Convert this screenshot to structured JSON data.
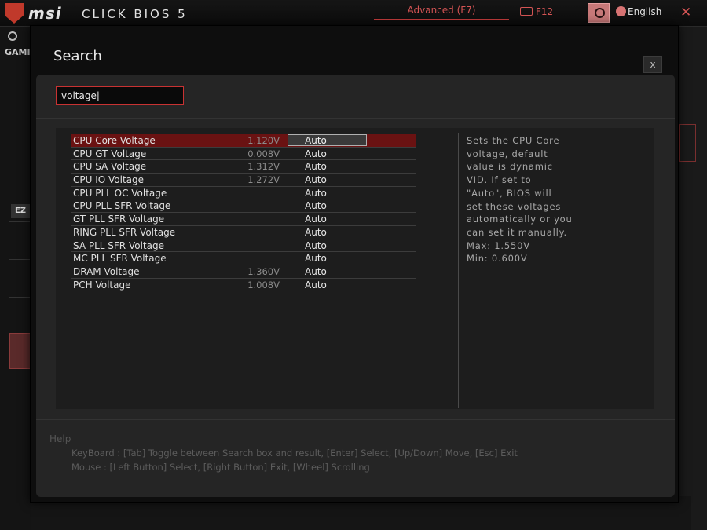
{
  "app": {
    "logo": "msi",
    "title": "CLICK BIOS 5",
    "mode_label": "Advanced (F7)",
    "screenshot_label": "F12",
    "language": "English"
  },
  "background": {
    "game_label": "GAMI",
    "ez_label": "EZ"
  },
  "modal": {
    "title": "Search",
    "close_label": "x",
    "search_value": "voltage|",
    "results": [
      {
        "name": "CPU Core Voltage",
        "current": "1.120V",
        "value": "Auto",
        "selected": true
      },
      {
        "name": "CPU GT Voltage",
        "current": "0.008V",
        "value": "Auto",
        "selected": false
      },
      {
        "name": "CPU SA Voltage",
        "current": "1.312V",
        "value": "Auto",
        "selected": false
      },
      {
        "name": "CPU IO Voltage",
        "current": "1.272V",
        "value": "Auto",
        "selected": false
      },
      {
        "name": "CPU PLL OC Voltage",
        "current": "",
        "value": "Auto",
        "selected": false
      },
      {
        "name": "CPU PLL SFR Voltage",
        "current": "",
        "value": "Auto",
        "selected": false
      },
      {
        "name": "GT PLL SFR Voltage",
        "current": "",
        "value": "Auto",
        "selected": false
      },
      {
        "name": "RING PLL SFR Voltage",
        "current": "",
        "value": "Auto",
        "selected": false
      },
      {
        "name": "SA PLL SFR Voltage",
        "current": "",
        "value": "Auto",
        "selected": false
      },
      {
        "name": "MC PLL SFR Voltage",
        "current": "",
        "value": "Auto",
        "selected": false
      },
      {
        "name": "DRAM Voltage",
        "current": "1.360V",
        "value": "Auto",
        "selected": false
      },
      {
        "name": "PCH Voltage",
        "current": "1.008V",
        "value": "Auto",
        "selected": false
      }
    ],
    "description": [
      "Sets the CPU Core",
      "voltage, default",
      "value is dynamic",
      "VID. If set to",
      "\"Auto\", BIOS will",
      "set these voltages",
      "automatically or you",
      "can set it manually.",
      "Max: 1.550V",
      "Min: 0.600V"
    ],
    "help": {
      "title": "Help",
      "keyboard": "KeyBoard :  [Tab]  Toggle between Search box and result,   [Enter]  Select,   [Up/Down]  Move,   [Esc]  Exit",
      "mouse": "Mouse     :  [Left Button]  Select,   [Right Button]  Exit,   [Wheel]  Scrolling"
    }
  },
  "colors": {
    "accent": "#c83232",
    "selected_row": "#6a1212"
  }
}
